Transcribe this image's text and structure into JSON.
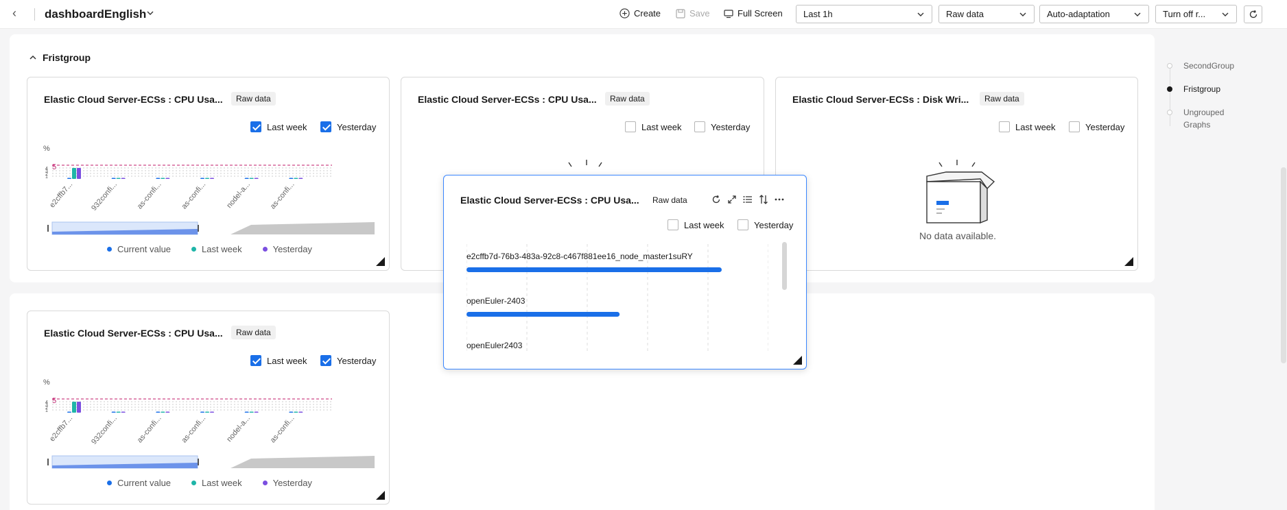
{
  "header": {
    "title": "dashboardEnglish",
    "create_label": "Create",
    "save_label": "Save",
    "fullscreen_label": "Full Screen",
    "time_range": "Last 1h",
    "data_mode": "Raw data",
    "adaptation": "Auto-adaptation",
    "refresh_mode": "Turn off r..."
  },
  "group": {
    "title": "Fristgroup"
  },
  "cards": [
    {
      "title": "Elastic Cloud Server-ECSs : CPU Usa...",
      "badge": "Raw data",
      "last_week_label": "Last week",
      "yesterday_label": "Yesterday",
      "last_week_checked": true,
      "yesterday_checked": true,
      "unit": "%",
      "threshold_label": "5",
      "legend": [
        "Current value",
        "Last week",
        "Yesterday"
      ]
    },
    {
      "title": "Elastic Cloud Server-ECSs : CPU Usa...",
      "badge": "Raw data",
      "last_week_label": "Last week",
      "yesterday_label": "Yesterday",
      "last_week_checked": false,
      "yesterday_checked": false
    },
    {
      "title": "Elastic Cloud Server-ECSs : Disk Wri...",
      "badge": "Raw data",
      "last_week_label": "Last week",
      "yesterday_label": "Yesterday",
      "last_week_checked": false,
      "yesterday_checked": false,
      "nodata": "No data available."
    },
    {
      "title": "Elastic Cloud Server-ECSs : CPU Usa...",
      "badge": "Raw data",
      "last_week_label": "Last week",
      "yesterday_label": "Yesterday",
      "last_week_checked": true,
      "yesterday_checked": true,
      "unit": "%",
      "threshold_label": "5",
      "legend": [
        "Current value",
        "Last week",
        "Yesterday"
      ]
    }
  ],
  "popup": {
    "title": "Elastic Cloud Server-ECSs : CPU Usa...",
    "badge": "Raw data",
    "last_week_label": "Last week",
    "yesterday_label": "Yesterday"
  },
  "anchors": [
    "SecondGroup",
    "Fristgroup",
    "Ungrouped Graphs"
  ],
  "colors": {
    "primary": "#1a6fe8",
    "last_week": "#1fb5a8",
    "yesterday": "#7b4fe0",
    "threshold": "#c0186a"
  },
  "chart_data": [
    {
      "type": "bar",
      "categories": [
        "e2cffb7...",
        "932confi...",
        "as-confi...",
        "as-confi...",
        "nodel-a...",
        "as-confi..."
      ],
      "ylabel": "%",
      "threshold": 5,
      "series": [
        {
          "name": "Current value",
          "values": [
            0.3,
            0.1,
            0.1,
            0.1,
            0.1,
            0.1
          ]
        },
        {
          "name": "Last week",
          "values": [
            4,
            0.1,
            0.1,
            0.1,
            0.1,
            0.1
          ]
        },
        {
          "name": "Yesterday",
          "values": [
            4,
            0.1,
            0.1,
            0.1,
            0.1,
            0.1
          ]
        }
      ]
    },
    {
      "type": "bar",
      "categories": [
        "e2cffb7d-76b3-483a-92c8-c467f881ee16_node_master1suRY",
        "openEuler-2403",
        "openEuler2403"
      ],
      "values": [
        100,
        60,
        null
      ]
    }
  ]
}
